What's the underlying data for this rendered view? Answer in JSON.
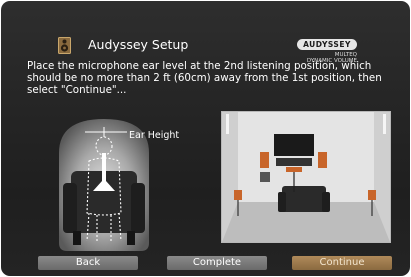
{
  "header": {
    "title": "Audyssey Setup",
    "speaker_icon": "speaker-icon"
  },
  "brand": {
    "name": "AUDYSSEY",
    "line1": "MULTEQ",
    "line2": "DYNAMIC VOLUME"
  },
  "instruction": "Place the microphone ear level at the 2nd listening position, which should be no more than 2 ft (60cm) away from the 1st position, then select \"Continue\"...",
  "illustration": {
    "ear_height_label": "Ear Height"
  },
  "buttons": {
    "back": "Back",
    "complete": "Complete",
    "continue": "Continue"
  },
  "colors": {
    "background": "#262626",
    "continue_button": "#9a7a4e",
    "neutral_button": "#7a7a7a",
    "speaker_accent": "#c8652a"
  }
}
